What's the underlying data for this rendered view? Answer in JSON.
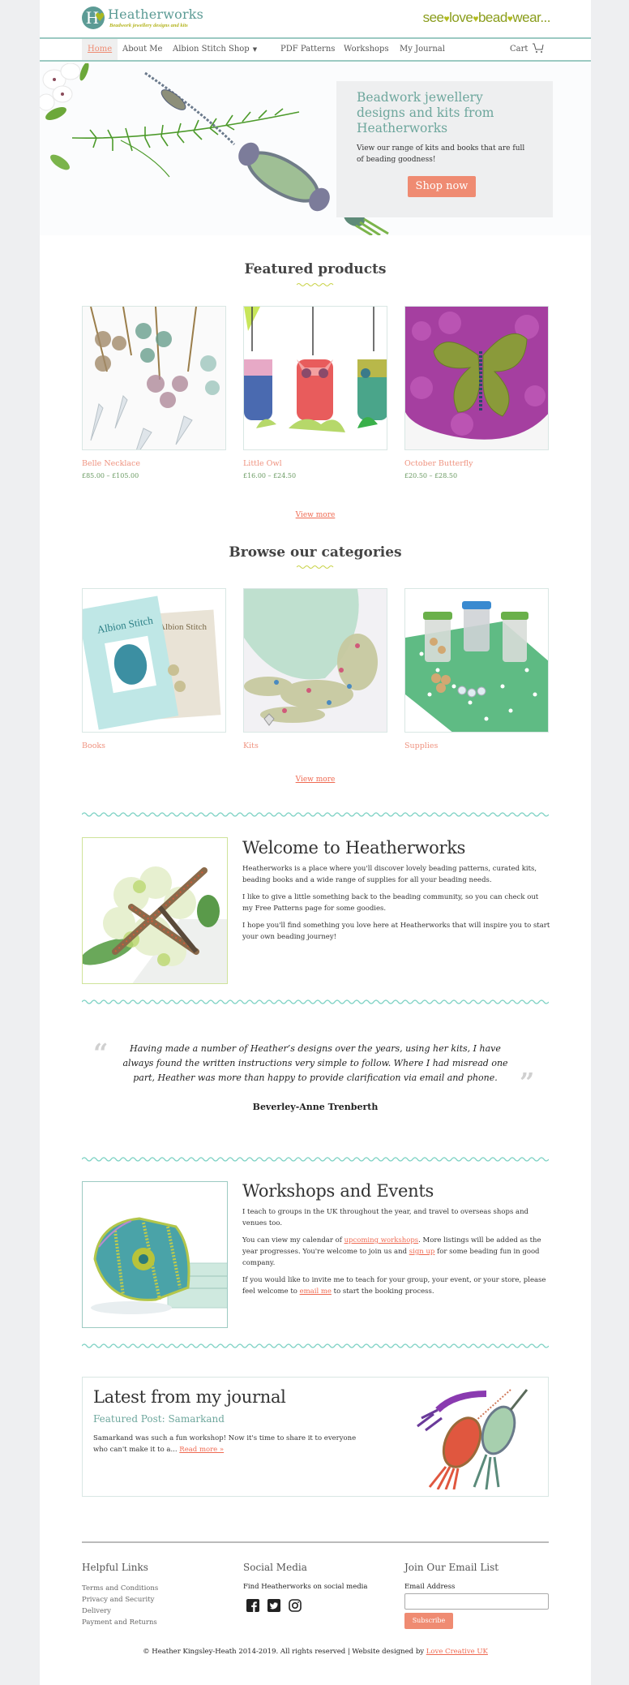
{
  "header": {
    "logo_letter": "H",
    "logo_name": "Heatherworks",
    "logo_tagline": "Beadwork jewellery designs and kits",
    "slogan": [
      "see",
      "love",
      "bead",
      "wear..."
    ],
    "slogan_separator": "♥"
  },
  "nav": {
    "items": [
      {
        "label": "Home",
        "active": true
      },
      {
        "label": "About Me"
      },
      {
        "label": "Albion Stitch"
      },
      {
        "label": "Shop",
        "dropdown": true
      },
      {
        "label": "PDF Patterns"
      },
      {
        "label": "Workshops"
      },
      {
        "label": "My Journal"
      }
    ],
    "cart_label": "Cart",
    "caret": "▼"
  },
  "hero": {
    "title": "Beadwork jewellery designs and kits from Heatherworks",
    "text": "View our range of kits and books that are full of beading goodness!",
    "button": "Shop now"
  },
  "featured": {
    "title": "Featured products",
    "products": [
      {
        "name": "Belle Necklace",
        "price": "£85.00 – £105.00"
      },
      {
        "name": "Little Owl",
        "price": "£16.00 – £24.50"
      },
      {
        "name": "October Butterfly",
        "price": "£20.50 – £28.50"
      }
    ],
    "view_more": "View more"
  },
  "categories": {
    "title": "Browse our categories",
    "items": [
      {
        "name": "Books"
      },
      {
        "name": "Kits"
      },
      {
        "name": "Supplies"
      }
    ],
    "view_more": "View more"
  },
  "welcome": {
    "title": "Welcome to Heatherworks",
    "paragraphs": [
      "Heatherworks is a place where you'll discover lovely beading patterns, curated kits, beading books and a wide range of supplies for all your beading needs.",
      "I like to give a little something back to the beading community, so you can check out my Free Patterns page for some goodies.",
      "I hope you'll find something you love here at Heatherworks that will inspire you to start your own beading journey!"
    ]
  },
  "testimonial": {
    "open_quote": "“",
    "close_quote": "”",
    "text": "Having made a number of Heather’s designs over the years, using her kits, I have always found the written instructions very simple to follow. Where I had misread one part, Heather was more than happy to provide clarification via email and phone.",
    "author": "Beverley-Anne Trenberth"
  },
  "workshops": {
    "title": "Workshops and Events",
    "p1": "I teach to groups in the UK throughout the year, and travel to overseas shops and venues too.",
    "p2_a": "You can view my calendar of ",
    "p2_link1": "upcoming workshops",
    "p2_b": ". More listings will be added as the year progresses. You're welcome to join us and ",
    "p2_link2": "sign up",
    "p2_c": " for some beading fun in good company.",
    "p3_a": "If you would like to invite me to teach for your group, your event, or your store, please feel welcome to ",
    "p3_link": "email me",
    "p3_b": " to start the booking process."
  },
  "journal": {
    "title": "Latest from my journal",
    "subtitle": "Featured Post: Samarkand",
    "excerpt": "Samarkand was such a fun workshop! Now it's time to share it to everyone who can't make it to a... ",
    "read_more": "Read more »"
  },
  "footer": {
    "helpful_title": "Helpful Links",
    "helpful_links": [
      "Terms and Conditions",
      "Privacy and Security",
      "Delivery",
      "Payment and Returns"
    ],
    "social_title": "Social Media",
    "social_text": "Find Heatherworks on social media",
    "social_icons": [
      "facebook-icon",
      "twitter-icon",
      "instagram-icon"
    ],
    "email_title": "Join Our Email List",
    "email_label": "Email Address",
    "email_value": "",
    "subscribe": "Subscribe",
    "copyright": "© Heather Kingsley-Heath 2014-2019. All rights reserved | Website designed by ",
    "designer_link": "Love Creative UK"
  },
  "colors": {
    "teal": "#5c9b95",
    "nav_rule": "#9ccac2",
    "accent_coral": "#ef8b72",
    "link": "#ef6a52",
    "price_green": "#6a9a62",
    "lime": "#b4bd1d"
  }
}
